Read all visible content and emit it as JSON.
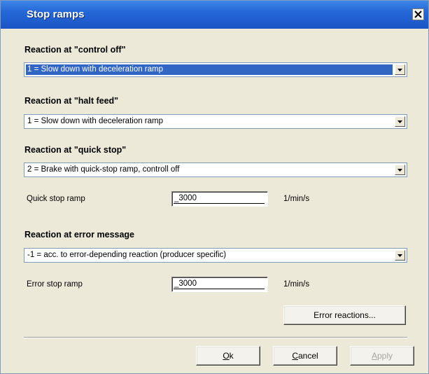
{
  "window": {
    "title": "Stop ramps",
    "close_icon": "close-x-icon"
  },
  "control_off": {
    "label": "Reaction at \"control off\"",
    "selected": "1 = Slow down with deceleration ramp"
  },
  "halt_feed": {
    "label": "Reaction at \"halt feed\"",
    "selected": "1 = Slow down with deceleration ramp"
  },
  "quick_stop": {
    "label": "Reaction at \"quick stop\"",
    "selected": "2 = Brake with quick-stop ramp, controll off",
    "ramp_label": "Quick stop ramp",
    "ramp_value": "_3000",
    "ramp_unit": "1/min/s"
  },
  "error_message": {
    "label": "Reaction at error message",
    "selected": "-1 = acc. to error-depending reaction (producer specific)",
    "ramp_label": "Error stop ramp",
    "ramp_value": "_3000",
    "ramp_unit": "1/min/s"
  },
  "buttons": {
    "error_reactions": "Error reactions...",
    "ok_mnemonic": "O",
    "ok_rest": "k",
    "cancel_mnemonic": "C",
    "cancel_rest": "ancel",
    "apply_mnemonic": "A",
    "apply_rest": "pply"
  }
}
